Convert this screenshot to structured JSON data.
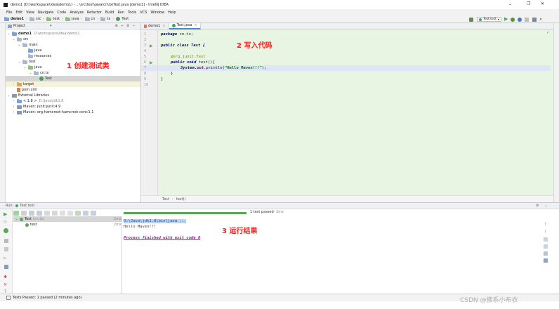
{
  "window": {
    "title": "demo1 [D:\\workspace\\idea\\demo1] - ...\\src\\test\\java\\cn\\tx\\Test.java [demo1] - IntelliJ IDEA",
    "minimize": "–",
    "maximize": "❐",
    "close": "✕"
  },
  "menu": [
    "File",
    "Edit",
    "View",
    "Navigate",
    "Code",
    "Analyze",
    "Refactor",
    "Build",
    "Run",
    "Tools",
    "VCS",
    "Window",
    "Help"
  ],
  "breadcrumb": [
    "demo1",
    "src",
    "test",
    "java",
    "cn",
    "tx",
    "Test"
  ],
  "toolbar": {
    "run_config": "Test.test"
  },
  "project_panel": {
    "header": "Project",
    "tree": {
      "root": "demo1",
      "root_path": "D:\\workspace\\idea\\demo1",
      "src": "src",
      "main": "main",
      "main_java": "java",
      "resources": "resources",
      "test": "test",
      "test_java": "java",
      "pkg": "cn.tx",
      "test_class": "Test",
      "target": "target",
      "pom": "pom.xml",
      "ext_libs": "External Libraries",
      "jdk": "< 1.8 >",
      "jdk_path": "D:\\Java\\jdk1.8",
      "lib_junit": "Maven: junit:junit:4.9",
      "lib_hamcrest": "Maven: org.hamcrest:hamcrest-core:1.1"
    }
  },
  "editor": {
    "tabs": [
      "demo1",
      "Test.java"
    ],
    "line_numbers": [
      "1",
      "2",
      "3",
      "4",
      "5",
      "6",
      "7",
      "8",
      "9",
      "10"
    ],
    "code": {
      "l1_kw": "package",
      "l1_rest": " cn.tx;",
      "l3_kw": "public class",
      "l3_rest": " Test {",
      "l5_ann": "@org.junit.Test",
      "l6_kw": "public void",
      "l6_rest": " test(){",
      "l7_pre": "System.",
      "l7_field": "out",
      "l7_mid": ".println(",
      "l7_str": "\"Hello Maven!!!\"",
      "l7_end": ");",
      "l8": "}",
      "l9": "}"
    },
    "breadcrumb": [
      "Test",
      "test()"
    ]
  },
  "callouts": {
    "c1": "1 创建测试类",
    "c2": "2 写入代码",
    "c3": "3 运行结果"
  },
  "run_panel": {
    "header": "Run:",
    "config": "Test.test",
    "progress_label": "1 test passed",
    "progress_time": "– 2ms",
    "tree": [
      {
        "label": "Test",
        "sub": "(cn.tx)",
        "time": "2ms"
      },
      {
        "label": "test",
        "sub": "",
        "time": "2ms"
      }
    ],
    "console": {
      "cmd": "D:\\Java\\jdk1.8\\bin\\java ...",
      "out": "Hello Maven!!!",
      "finish": "Process finished with exit code 0"
    }
  },
  "status_bar": {
    "text": "Tests Passed: 1 passed (2 minutes ago)"
  },
  "watermark": "CSDN @佛系小布衣",
  "colors": {
    "editor_bg": "#e9f5e3",
    "current_line": "#dde5f6",
    "callout": "#ff2020",
    "pass_green": "#5aa55a"
  }
}
